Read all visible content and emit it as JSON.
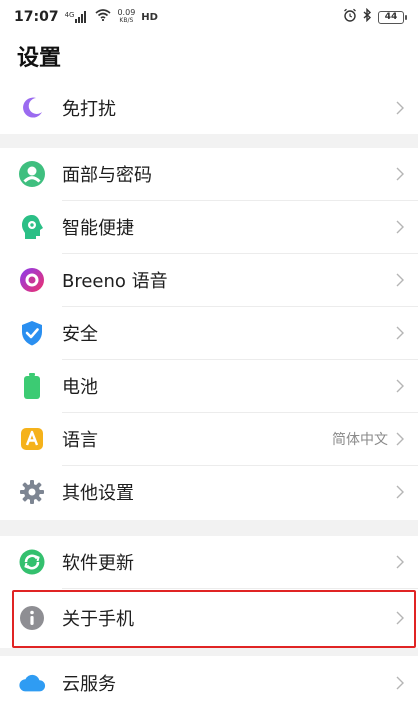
{
  "status_bar": {
    "time": "17:07",
    "signal_tag": "4G",
    "net_speed_value": "0.09",
    "net_speed_unit": "KB/S",
    "hd": "HD",
    "battery": "44"
  },
  "header": {
    "title": "设置"
  },
  "rows": [
    {
      "label": "免打扰",
      "icon": "moon-icon"
    },
    {
      "label": "面部与密码",
      "icon": "face-user-icon"
    },
    {
      "label": "智能便捷",
      "icon": "smart-head-icon"
    },
    {
      "label": "Breeno 语音",
      "icon": "breeno-icon"
    },
    {
      "label": "安全",
      "icon": "shield-check-icon"
    },
    {
      "label": "电池",
      "icon": "battery-icon"
    },
    {
      "label": "语言",
      "icon": "language-icon",
      "value": "简体中文"
    },
    {
      "label": "其他设置",
      "icon": "gear-icon"
    },
    {
      "label": "软件更新",
      "icon": "update-icon"
    },
    {
      "label": "关于手机",
      "icon": "info-icon"
    },
    {
      "label": "云服务",
      "icon": "cloud-icon"
    }
  ],
  "colors": {
    "moon": "#9b6bf0",
    "face": "#3fbf7f",
    "smart": "#2bbf86",
    "breeno": "#c6359a",
    "shield": "#2a8ff0",
    "battery": "#3ccb73",
    "language": "#f5b21b",
    "gear": "#7d8592",
    "update": "#34c06e",
    "info": "#8e8e93",
    "cloud": "#2f9cf3",
    "highlight": "#e02424"
  }
}
